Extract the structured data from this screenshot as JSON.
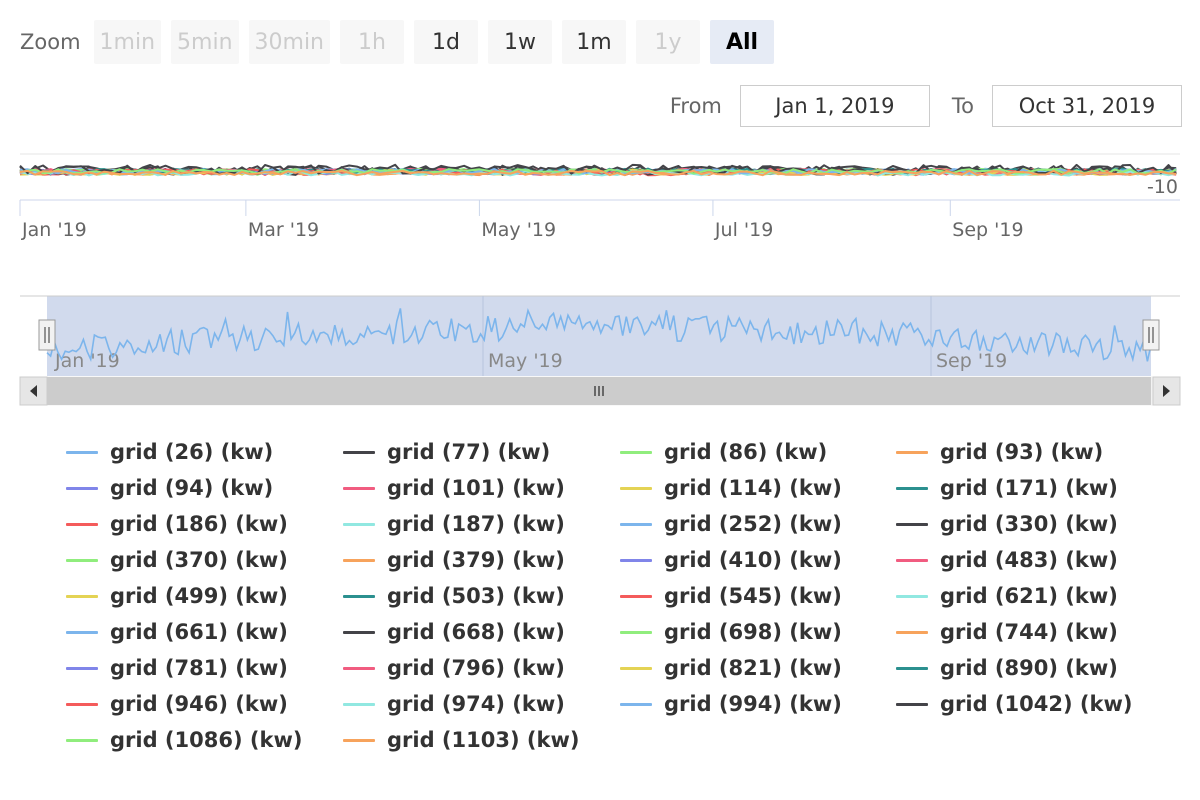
{
  "zoom": {
    "label": "Zoom",
    "buttons": [
      {
        "label": "1min",
        "state": "disabled"
      },
      {
        "label": "5min",
        "state": "disabled"
      },
      {
        "label": "30min",
        "state": "disabled"
      },
      {
        "label": "1h",
        "state": "disabled"
      },
      {
        "label": "1d",
        "state": "normal"
      },
      {
        "label": "1w",
        "state": "normal"
      },
      {
        "label": "1m",
        "state": "normal"
      },
      {
        "label": "1y",
        "state": "disabled"
      },
      {
        "label": "All",
        "state": "selected"
      }
    ]
  },
  "range": {
    "from_label": "From",
    "from_value": "Jan 1, 2019",
    "to_label": "To",
    "to_value": "Oct 31, 2019"
  },
  "navigator": {
    "scroll_left_icon": "arrow-left-icon",
    "scroll_right_icon": "arrow-right-icon",
    "grip_icon": "grip-icon",
    "handle_icon": "handle-icon",
    "tick_labels": [
      "Jan '19",
      "May '19",
      "Sep '19"
    ]
  },
  "chart_data": {
    "type": "line",
    "x_range": [
      "2019-01-01",
      "2019-10-31"
    ],
    "x_tick_labels": [
      "Jan '19",
      "Mar '19",
      "May '19",
      "Jul '19",
      "Sep '19"
    ],
    "y_tick_labels": [
      "-10"
    ],
    "legend_position": "bottom",
    "series_colors": [
      "#7cb5ec",
      "#434348",
      "#90ed7d",
      "#f7a35c",
      "#8085e9",
      "#f15c80",
      "#e4d354",
      "#2b908f",
      "#f45b5b",
      "#91e8e1"
    ],
    "series": [
      {
        "name": "grid (26) (kw)"
      },
      {
        "name": "grid (77) (kw)"
      },
      {
        "name": "grid (86) (kw)"
      },
      {
        "name": "grid (93) (kw)"
      },
      {
        "name": "grid (94) (kw)"
      },
      {
        "name": "grid (101) (kw)"
      },
      {
        "name": "grid (114) (kw)"
      },
      {
        "name": "grid (171) (kw)"
      },
      {
        "name": "grid (186) (kw)"
      },
      {
        "name": "grid (187) (kw)"
      },
      {
        "name": "grid (252) (kw)"
      },
      {
        "name": "grid (330) (kw)"
      },
      {
        "name": "grid (370) (kw)"
      },
      {
        "name": "grid (379) (kw)"
      },
      {
        "name": "grid (410) (kw)"
      },
      {
        "name": "grid (483) (kw)"
      },
      {
        "name": "grid (499) (kw)"
      },
      {
        "name": "grid (503) (kw)"
      },
      {
        "name": "grid (545) (kw)"
      },
      {
        "name": "grid (621) (kw)"
      },
      {
        "name": "grid (661) (kw)"
      },
      {
        "name": "grid (668) (kw)"
      },
      {
        "name": "grid (698) (kw)"
      },
      {
        "name": "grid (744) (kw)"
      },
      {
        "name": "grid (781) (kw)"
      },
      {
        "name": "grid (796) (kw)"
      },
      {
        "name": "grid (821) (kw)"
      },
      {
        "name": "grid (890) (kw)"
      },
      {
        "name": "grid (946) (kw)"
      },
      {
        "name": "grid (974) (kw)"
      },
      {
        "name": "grid (994) (kw)"
      },
      {
        "name": "grid (1042) (kw)"
      },
      {
        "name": "grid (1086) (kw)"
      },
      {
        "name": "grid (1103) (kw)"
      }
    ]
  }
}
